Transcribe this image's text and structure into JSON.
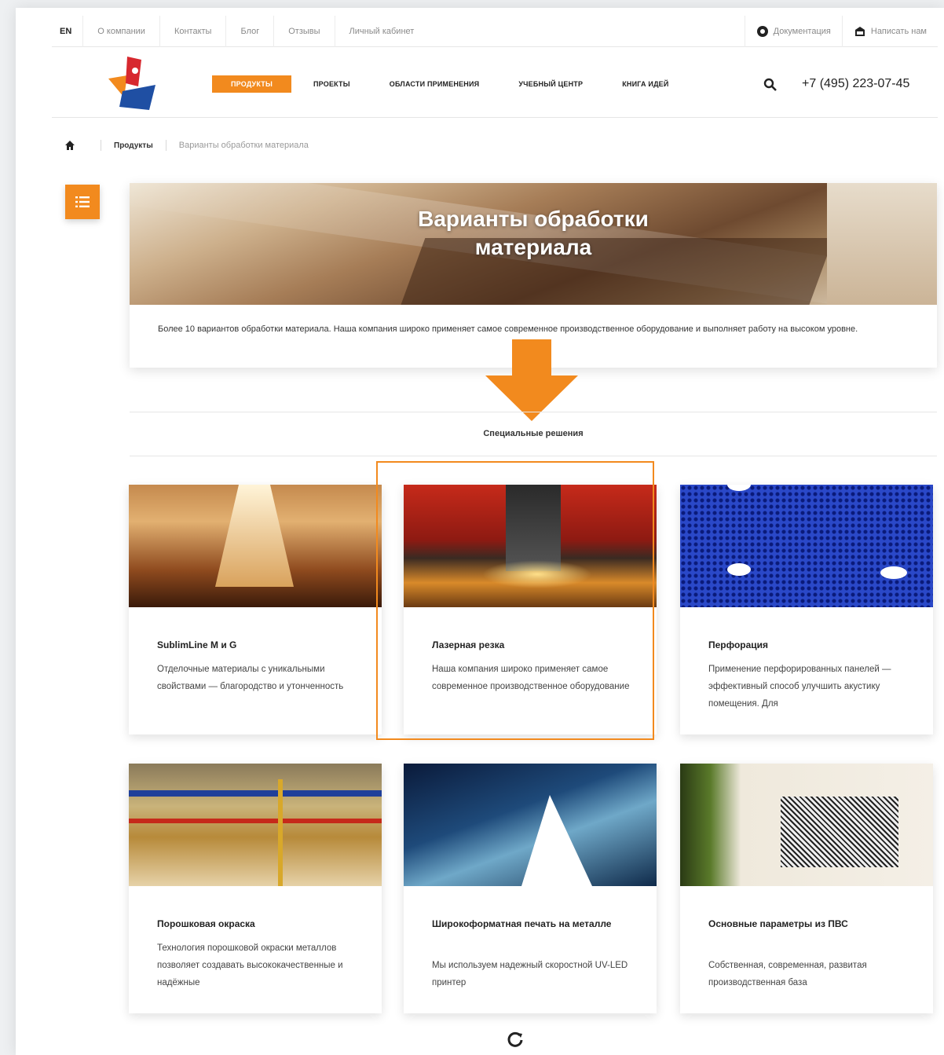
{
  "topbar": {
    "lang": "EN",
    "links": [
      "О компании",
      "Контакты",
      "Блог",
      "Отзывы",
      "Личный кабинет"
    ],
    "docs": "Документация",
    "write": "Написать нам"
  },
  "nav": {
    "items": [
      "ПРОДУКТЫ",
      "ПРОЕКТЫ",
      "ОБЛАСТИ ПРИМЕНЕНИЯ",
      "УЧЕБНЫЙ ЦЕНТР",
      "КНИГА ИДЕЙ"
    ],
    "phone": "+7 (495) 223-07-45"
  },
  "breadcrumb": {
    "products": "Продукты",
    "current": "Варианты обработки материала"
  },
  "hero": {
    "title_line1": "Варианты обработки",
    "title_line2": "материала",
    "text": "Более 10 вариантов обработки материала. Наша компания широко применяет самое современное производственное оборудование и выполняет работу на высоком уровне."
  },
  "section": {
    "title": "Специальные решения"
  },
  "cards": [
    {
      "title": "SublimLine M и G",
      "desc": "Отделочные материалы с уникальными свойствами — благородство и утонченность"
    },
    {
      "title": "Лазерная резка",
      "desc": "Наша компания широко применяет самое современное производственное оборудование"
    },
    {
      "title": "Перфорация",
      "desc": "Применение перфорированных панелей — эффективный способ улучшить акустику помещения. Для"
    },
    {
      "title": "Порошковая окраска",
      "desc": "Технология порошковой окраски металлов позволяет создавать высококачественные и надёжные"
    },
    {
      "title": "Широкоформатная печать на металле",
      "desc": "Мы используем надежный скоростной UV-LED принтер"
    },
    {
      "title": "Основные параметры из ПВС",
      "desc": "Собственная, современная, развитая производственная база"
    }
  ],
  "colors": {
    "accent": "#f28a1e",
    "text": "#333333"
  },
  "icons": [
    "home-icon",
    "menu-list-icon",
    "search-icon",
    "docs-icon",
    "mail-icon",
    "refresh-icon",
    "down-arrow-icon"
  ]
}
